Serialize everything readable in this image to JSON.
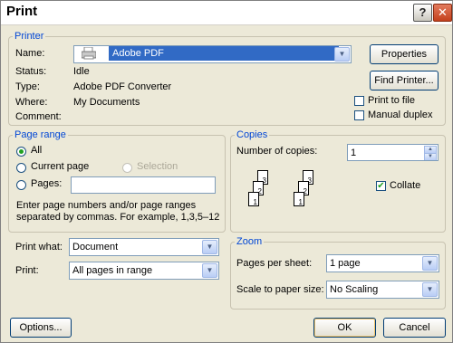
{
  "window": {
    "title": "Print",
    "help_button": "?",
    "close_button": "✕"
  },
  "printer": {
    "legend": "Printer",
    "name_label": "Name:",
    "name_value": "Adobe PDF",
    "status_label": "Status:",
    "status_value": "Idle",
    "type_label": "Type:",
    "type_value": "Adobe PDF Converter",
    "where_label": "Where:",
    "where_value": "My Documents",
    "comment_label": "Comment:",
    "comment_value": "",
    "properties_button": "Properties",
    "find_printer_button": "Find Printer...",
    "print_to_file_label": "Print to file",
    "manual_duplex_label": "Manual duplex"
  },
  "page_range": {
    "legend": "Page range",
    "all_label": "All",
    "current_page_label": "Current page",
    "selection_label": "Selection",
    "pages_label": "Pages:",
    "pages_value": "",
    "hint_line1": "Enter page numbers and/or page ranges",
    "hint_line2": "separated by commas.  For example, 1,3,5–12"
  },
  "copies": {
    "legend": "Copies",
    "number_label": "Number of copies:",
    "number_value": "1",
    "collate_label": "Collate",
    "page_numbers": [
      "3",
      "2",
      "1",
      "3",
      "2",
      "1"
    ]
  },
  "print_what": {
    "label": "Print what:",
    "value": "Document"
  },
  "print": {
    "label": "Print:",
    "value": "All pages in range"
  },
  "zoom": {
    "legend": "Zoom",
    "pages_per_sheet_label": "Pages per sheet:",
    "pages_per_sheet_value": "1 page",
    "scale_label": "Scale to paper size:",
    "scale_value": "No Scaling"
  },
  "footer": {
    "options_button": "Options...",
    "ok_button": "OK",
    "cancel_button": "Cancel"
  }
}
